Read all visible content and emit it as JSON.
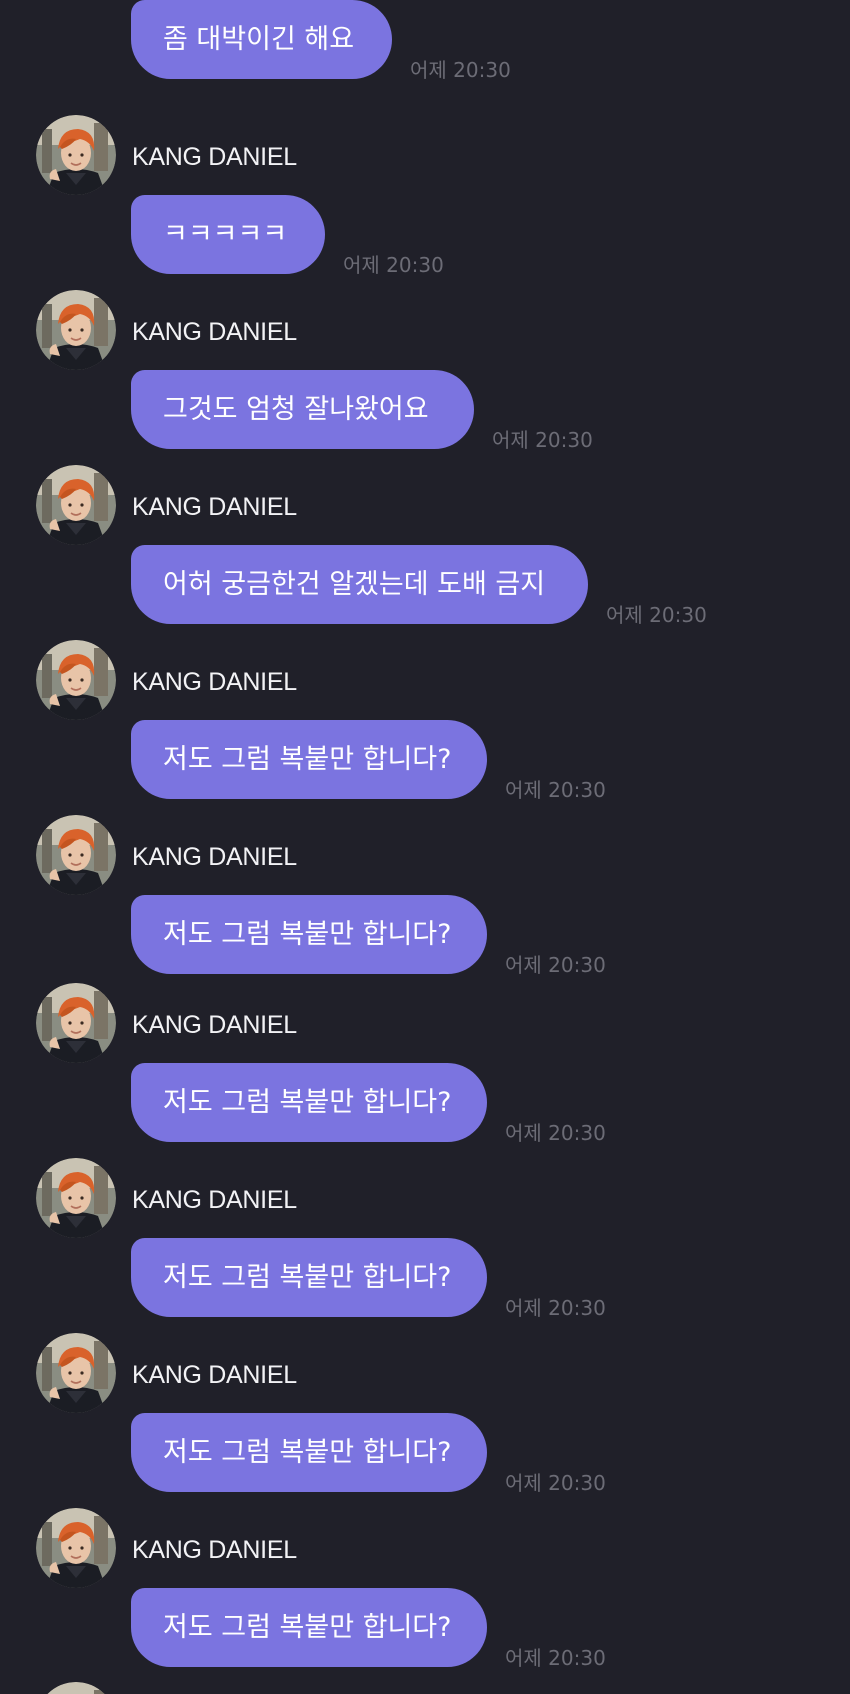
{
  "colors": {
    "background": "#202029",
    "bubble": "#7b74e0",
    "bubble_text": "#ffffff",
    "sender_text": "#f2f2f5",
    "time_text": "#6c6c76"
  },
  "messages": [
    {
      "sender": "",
      "text": "좀 대박이긴 해요",
      "time": "어제 20:30",
      "show_avatar": false
    },
    {
      "sender": "KANG DANIEL",
      "text": "ㅋㅋㅋㅋㅋ",
      "time": "어제 20:30",
      "show_avatar": true
    },
    {
      "sender": "KANG DANIEL",
      "text": "그것도 엄청 잘나왔어요",
      "time": "어제 20:30",
      "show_avatar": true
    },
    {
      "sender": "KANG DANIEL",
      "text": "어허 궁금한건 알겠는데 도배 금지",
      "time": "어제 20:30",
      "show_avatar": true
    },
    {
      "sender": "KANG DANIEL",
      "text": "저도 그럼 복붙만 합니다?",
      "time": "어제 20:30",
      "show_avatar": true
    },
    {
      "sender": "KANG DANIEL",
      "text": "저도 그럼 복붙만 합니다?",
      "time": "어제 20:30",
      "show_avatar": true
    },
    {
      "sender": "KANG DANIEL",
      "text": "저도 그럼 복붙만 합니다?",
      "time": "어제 20:30",
      "show_avatar": true
    },
    {
      "sender": "KANG DANIEL",
      "text": "저도 그럼 복붙만 합니다?",
      "time": "어제 20:30",
      "show_avatar": true
    },
    {
      "sender": "KANG DANIEL",
      "text": "저도 그럼 복붙만 합니다?",
      "time": "어제 20:30",
      "show_avatar": true
    },
    {
      "sender": "KANG DANIEL",
      "text": "저도 그럼 복붙만 합니다?",
      "time": "어제 20:30",
      "show_avatar": true
    }
  ],
  "avatar_icon": "profile-photo"
}
